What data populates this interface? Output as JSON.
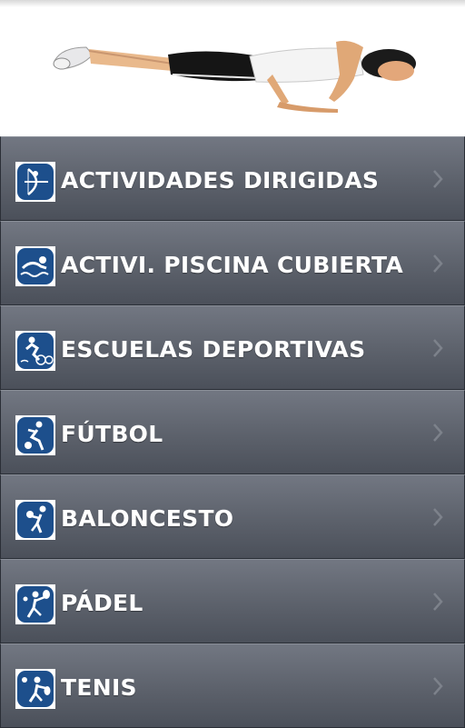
{
  "header": {
    "banner_image": "pushup-illustration"
  },
  "menu": {
    "items": [
      {
        "label": "ACTIVIDADES DIRIGIDAS",
        "icon": "archery-icon"
      },
      {
        "label": "ACTIVI. PISCINA CUBIERTA",
        "icon": "swimming-icon"
      },
      {
        "label": "ESCUELAS DEPORTIVAS",
        "icon": "triathlon-icon"
      },
      {
        "label": "FÚTBOL",
        "icon": "football-icon"
      },
      {
        "label": "BALONCESTO",
        "icon": "basketball-icon"
      },
      {
        "label": "PÁDEL",
        "icon": "padel-icon"
      },
      {
        "label": "TENIS",
        "icon": "tennis-icon"
      }
    ]
  },
  "colors": {
    "menu_background": "#5c616b",
    "icon_blue": "#1d4f8c",
    "label_text": "#ffffff",
    "chevron": "#7d828b"
  }
}
